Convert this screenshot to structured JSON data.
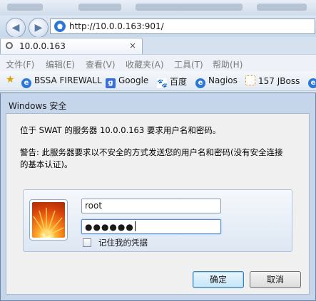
{
  "browser": {
    "address_url": "http://10.0.0.163:901/",
    "tab_title": "10.0.0.163",
    "tab_close": "×",
    "menu": [
      "文件(F)",
      "编辑(E)",
      "查看(V)",
      "收藏夹(A)",
      "工具(T)",
      "帮助(H)"
    ],
    "favorites": [
      {
        "label": "BSSA FIREWALL",
        "icon": "ie-page-icon"
      },
      {
        "label": "Google",
        "icon": "google-icon"
      },
      {
        "label": "百度",
        "icon": "baidu-paw-icon"
      },
      {
        "label": "Nagios",
        "icon": "ie-page-icon"
      },
      {
        "label": "157 JBoss",
        "icon": "loading-icon"
      }
    ]
  },
  "dialog": {
    "title": "Windows 安全",
    "message": "位于 SWAT 的服务器 10.0.0.163 要求用户名和密码。",
    "warning_line1": "警告: 此服务器要求以不安全的方式发送您的用户名和密码(没有安全连接",
    "warning_line2": "的基本认证)。",
    "username": "root",
    "password_mask": "●●●●●●",
    "remember_label": "记住我的凭据",
    "ok_label": "确定",
    "cancel_label": "取消"
  },
  "colors": {
    "dialog_frame": "#c5d6ea",
    "ok_button": "#c4e5f6"
  }
}
